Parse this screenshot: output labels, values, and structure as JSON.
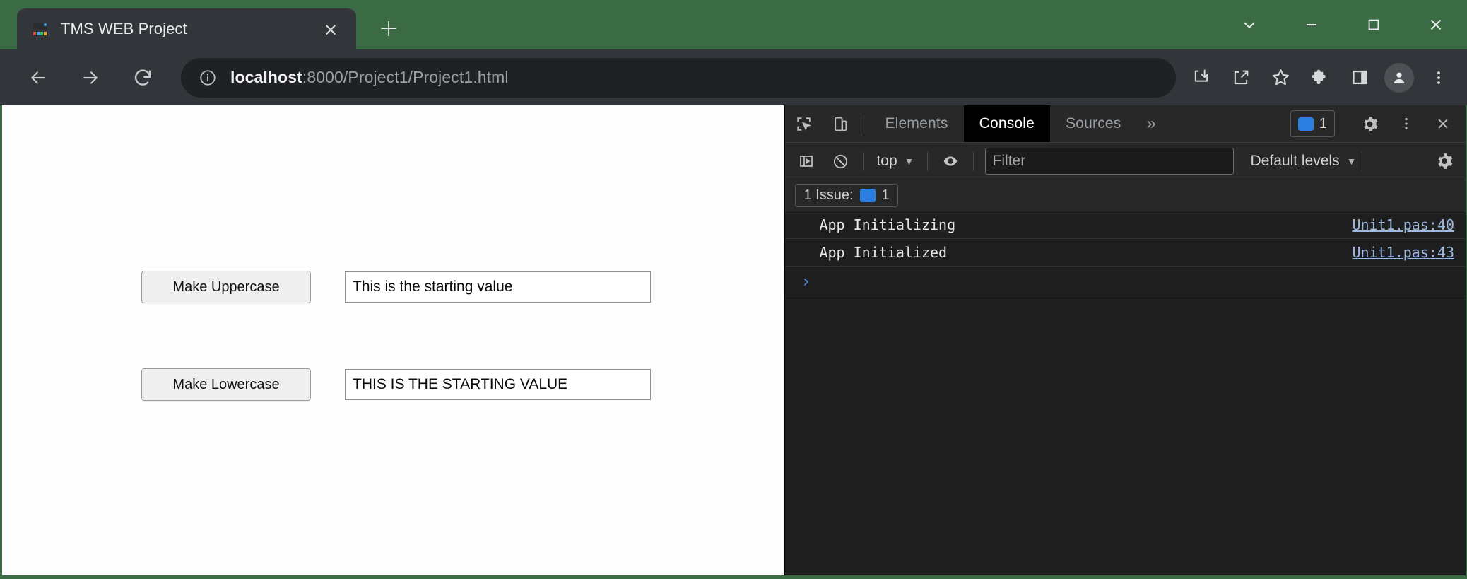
{
  "window": {
    "accent_color": "#3a6b42",
    "controls": [
      {
        "name": "tab-search",
        "icon": "chevron-down-icon"
      },
      {
        "name": "minimize",
        "icon": "minimize-icon"
      },
      {
        "name": "maximize",
        "icon": "maximize-icon"
      },
      {
        "name": "close",
        "icon": "close-icon"
      }
    ]
  },
  "tabstrip": {
    "tab_title": "TMS WEB Project",
    "close_label": "×",
    "newtab_label": "+",
    "favicon_name": "tms-favicon"
  },
  "toolbar": {
    "back_icon": "back-arrow-icon",
    "forward_icon": "forward-arrow-icon",
    "reload_icon": "reload-icon",
    "site_info_icon": "info-circle-icon",
    "url_host": "localhost",
    "url_rest": ":8000/Project1/Project1.html",
    "url_full": "localhost:8000/Project1/Project1.html",
    "icons": [
      {
        "name": "install-app-icon",
        "title": "Install"
      },
      {
        "name": "share-icon",
        "title": "Share"
      },
      {
        "name": "bookmark-star-icon",
        "title": "Bookmark"
      },
      {
        "name": "extensions-puzzle-icon",
        "title": "Extensions"
      },
      {
        "name": "side-panel-icon",
        "title": "Side panel"
      },
      {
        "name": "profile-avatar-icon",
        "title": "Profile"
      },
      {
        "name": "more-menu-icon",
        "title": "Customize and control"
      }
    ]
  },
  "page": {
    "controls": [
      {
        "button_label": "Make Uppercase",
        "input_value": "This is the starting value"
      },
      {
        "button_label": "Make Lowercase",
        "input_value": "THIS IS THE STARTING VALUE"
      }
    ]
  },
  "devtools": {
    "inspect_icon": "inspect-element-icon",
    "device_icon": "device-toolbar-icon",
    "tabs": [
      {
        "label": "Elements",
        "active": false
      },
      {
        "label": "Console",
        "active": true
      },
      {
        "label": "Sources",
        "active": false
      }
    ],
    "overflow_label": "»",
    "message_count": "1",
    "settings_icon": "gear-icon",
    "more_icon": "more-vertical-icon",
    "close_icon": "close-icon",
    "console_toolbar": {
      "sidebar_icon": "console-sidebar-icon",
      "clear_icon": "clear-console-icon",
      "context_label": "top",
      "context_caret": "▼",
      "eye_icon": "live-expression-eye-icon",
      "filter_placeholder": "Filter",
      "filter_value": "",
      "levels_label": "Default levels",
      "levels_caret": "▼",
      "settings_icon": "gear-icon"
    },
    "issues_bar": {
      "label": "1 Issue:",
      "count": "1",
      "icon": "message-badge-icon"
    },
    "messages": [
      {
        "text": "App Initializing",
        "source": "Unit1.pas:40"
      },
      {
        "text": "App Initialized",
        "source": "Unit1.pas:43"
      }
    ],
    "prompt_caret": "›"
  }
}
